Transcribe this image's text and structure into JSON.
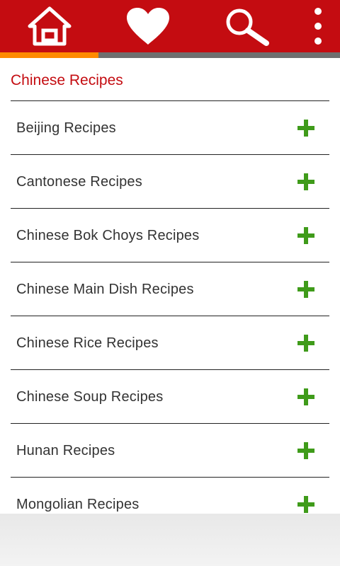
{
  "toolbar": {
    "background_color": "#c40c11",
    "buttons": [
      {
        "icon": "home-icon"
      },
      {
        "icon": "heart-icon"
      },
      {
        "icon": "search-icon"
      },
      {
        "icon": "more-vert-icon"
      }
    ],
    "active_tab_color": "#ff8a00",
    "inactive_tab_color": "#6f6f6f",
    "active_tab_index": 0
  },
  "section": {
    "title": "Chinese Recipes",
    "title_color": "#c40c11"
  },
  "recipes": [
    {
      "label": "Beijing Recipes",
      "icon": "plus-icon"
    },
    {
      "label": "Cantonese Recipes",
      "icon": "plus-icon"
    },
    {
      "label": "Chinese Bok Choys Recipes",
      "icon": "plus-icon"
    },
    {
      "label": "Chinese Main Dish Recipes",
      "icon": "plus-icon"
    },
    {
      "label": "Chinese Rice Recipes",
      "icon": "plus-icon"
    },
    {
      "label": "Chinese Soup Recipes",
      "icon": "plus-icon"
    },
    {
      "label": "Hunan Recipes",
      "icon": "plus-icon"
    },
    {
      "label": "Mongolian Recipes",
      "icon": "plus-icon"
    }
  ],
  "colors": {
    "plus_icon": "#3f9b1a",
    "item_text": "#333333",
    "divider": "#222222"
  }
}
